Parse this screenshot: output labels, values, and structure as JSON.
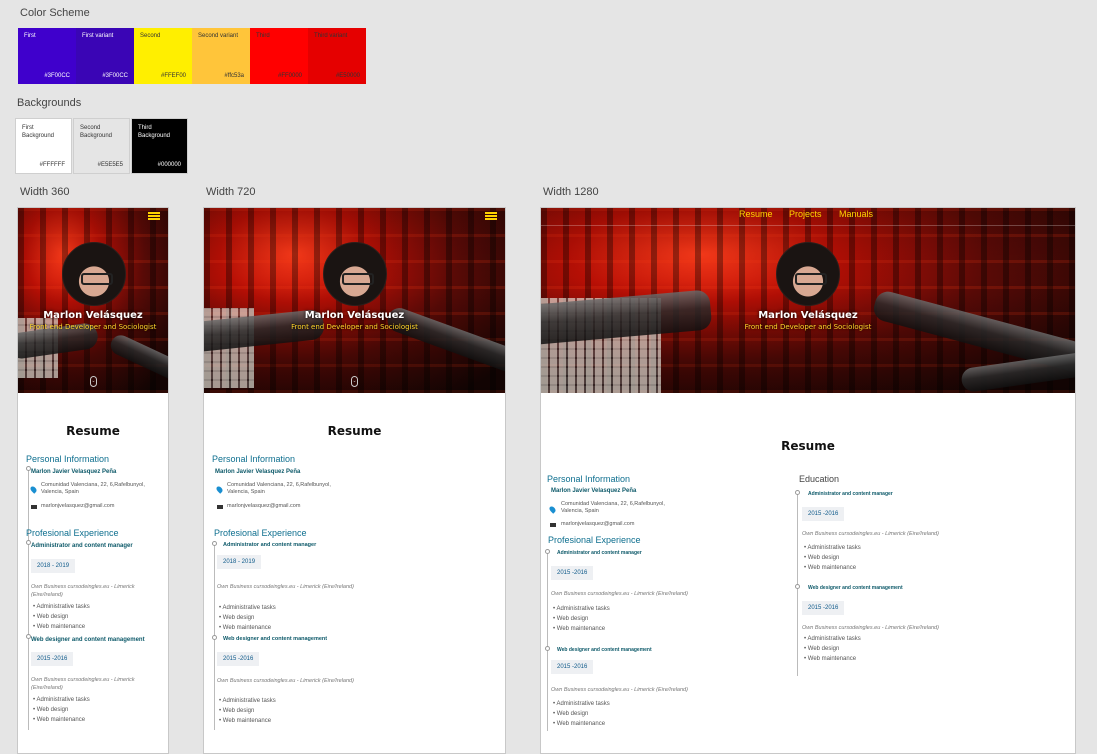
{
  "labels": {
    "color_scheme": "Color Scheme",
    "backgrounds": "Backgrounds",
    "width_360": "Width 360",
    "width_720": "Width 720",
    "width_1280": "Width 1280"
  },
  "swatches": [
    {
      "name": "First",
      "hex": "#3F00CC",
      "color": "#3F00CC",
      "text": "#ffffff"
    },
    {
      "name": "First variant",
      "hex": "#3F00CC",
      "color": "#3A05B5",
      "text": "#ffffff"
    },
    {
      "name": "Second",
      "hex": "#FFEF00",
      "color": "#FFEF00",
      "text": "#333333"
    },
    {
      "name": "Second variant",
      "hex": "#ffc53a",
      "color": "#FFC53A",
      "text": "#333333"
    },
    {
      "name": "Third",
      "hex": "#FF0000",
      "color": "#FF0000",
      "text": "#333333"
    },
    {
      "name": "Third variant",
      "hex": "#E50000",
      "color": "#E50000",
      "text": "#333333"
    }
  ],
  "backgrounds": [
    {
      "line1": "First",
      "line2": "Background",
      "hex": "#FFFFFF",
      "color": "#FFFFFF",
      "text": "#333333"
    },
    {
      "line1": "Second",
      "line2": "Background",
      "hex": "#E5E5E5",
      "color": "#E5E5E5",
      "text": "#333333"
    },
    {
      "line1": "Third",
      "line2": "Background",
      "hex": "#000000",
      "color": "#000000",
      "text": "#ffffff"
    }
  ],
  "profile": {
    "name": "Marlon Velásquez",
    "role": "Front end Developer and Sociologist",
    "full_name": "Marlon Javier Velasquez Peña",
    "address_line1": "Comunidad Valenciana, 22, 6,Rafelbunyol,",
    "address_line2": "Valencia, Spain",
    "email": "marlonjvelasquez@gmail.com"
  },
  "resume": {
    "title": "Resume",
    "personal_info": "Personal Information",
    "experience": "Profesional Experience",
    "education": "Education"
  },
  "jobs": [
    {
      "title": "Administrator and content manager",
      "dates": "2018 - 2019",
      "company": "Own Business cursodeingles.eu - Limerick (Eire/Ireland)",
      "tasks": [
        "Administrative tasks",
        "Web design",
        "Web maintenance"
      ]
    },
    {
      "title": "Web designer and content management",
      "dates": "2015 -2016",
      "company": "Own Business cursodeingles.eu - Limerick (Eire/Ireland)",
      "tasks": [
        "Administrative tasks",
        "Web design",
        "Web maintenance"
      ]
    }
  ],
  "jobs_1280": [
    {
      "title": "Administrator and content manager",
      "dates": "2015 -2016",
      "company": "Own Business cursodeingles.eu - Limerick (Eire/Ireland)",
      "tasks": [
        "Administrative tasks",
        "Web design",
        "Web maintenance"
      ]
    },
    {
      "title": "Web designer and content management",
      "dates": "2015 -2016",
      "company": "Own Business cursodeingles.eu - Limerick (Eire/Ireland)",
      "tasks": [
        "Administrative tasks",
        "Web design",
        "Web maintenance"
      ]
    }
  ],
  "nav": {
    "resume": "Resume",
    "projects": "Projects",
    "manuals": "Manuals"
  },
  "icons": {
    "menu": "hamburger-icon",
    "scroll": "mouse-scroll-icon",
    "location": "location-pin-icon",
    "email": "envelope-icon"
  }
}
